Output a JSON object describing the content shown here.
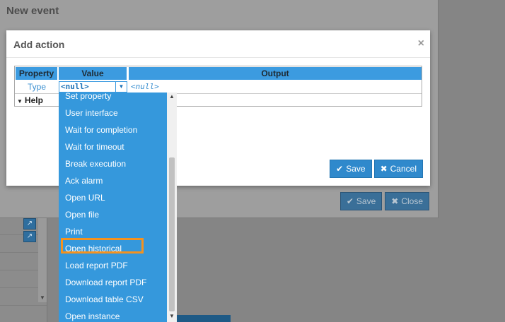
{
  "background": {
    "new_event_title": "New event",
    "save_label": "Save",
    "close_label": "Close"
  },
  "add_action": {
    "title": "Add action",
    "close_glyph": "×",
    "table": {
      "headers": {
        "property": "Property",
        "value": "Value",
        "output": "Output"
      },
      "rows": [
        {
          "property": "Type",
          "value": "<null>",
          "output": "<null>"
        }
      ],
      "help_label": "Help"
    },
    "save_label": "Save",
    "cancel_label": "Cancel"
  },
  "dropdown": {
    "items": [
      "Set property",
      "User interface",
      "Wait for completion",
      "Wait for timeout",
      "Break execution",
      "Ack alarm",
      "Open URL",
      "Open file",
      "Print",
      "Open historical",
      "Load report PDF",
      "Download report PDF",
      "Download table CSV",
      "Open instance"
    ],
    "highlighted": "Open historical"
  },
  "colors": {
    "accent": "#3598dc",
    "highlight": "#f4921f",
    "button": "#2f89cc"
  },
  "icons": {
    "save": "check-icon",
    "cancel": "x-icon",
    "dropdown": "caret-down-icon",
    "help": "caret-down-icon"
  }
}
